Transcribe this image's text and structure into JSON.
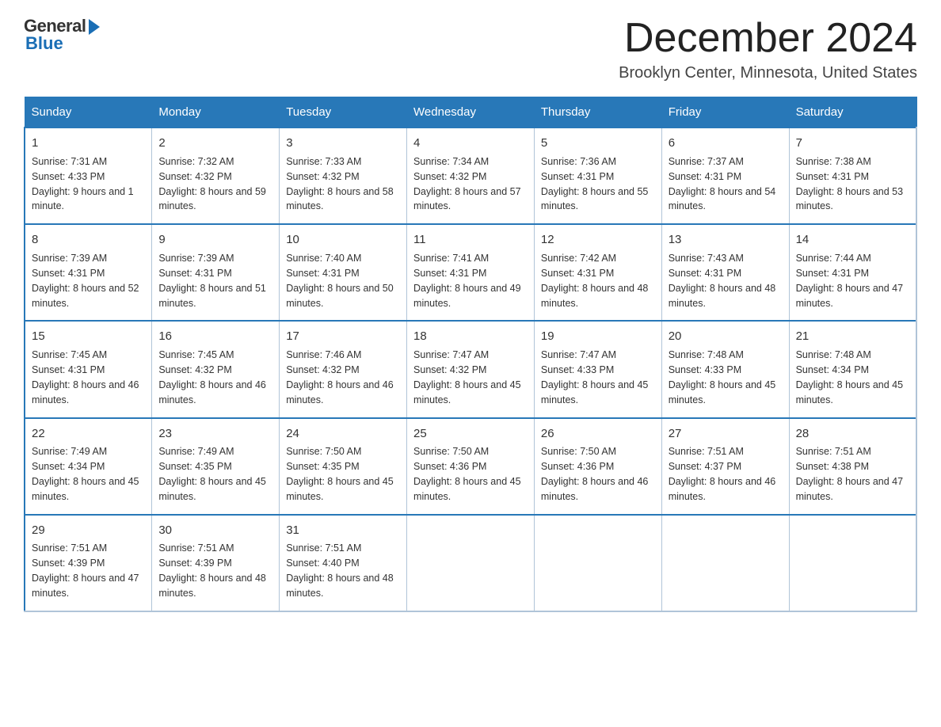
{
  "header": {
    "logo_general": "General",
    "logo_blue": "Blue",
    "month_title": "December 2024",
    "location": "Brooklyn Center, Minnesota, United States"
  },
  "days_of_week": [
    "Sunday",
    "Monday",
    "Tuesday",
    "Wednesday",
    "Thursday",
    "Friday",
    "Saturday"
  ],
  "weeks": [
    [
      {
        "day": "1",
        "sunrise": "7:31 AM",
        "sunset": "4:33 PM",
        "daylight": "9 hours and 1 minute."
      },
      {
        "day": "2",
        "sunrise": "7:32 AM",
        "sunset": "4:32 PM",
        "daylight": "8 hours and 59 minutes."
      },
      {
        "day": "3",
        "sunrise": "7:33 AM",
        "sunset": "4:32 PM",
        "daylight": "8 hours and 58 minutes."
      },
      {
        "day": "4",
        "sunrise": "7:34 AM",
        "sunset": "4:32 PM",
        "daylight": "8 hours and 57 minutes."
      },
      {
        "day": "5",
        "sunrise": "7:36 AM",
        "sunset": "4:31 PM",
        "daylight": "8 hours and 55 minutes."
      },
      {
        "day": "6",
        "sunrise": "7:37 AM",
        "sunset": "4:31 PM",
        "daylight": "8 hours and 54 minutes."
      },
      {
        "day": "7",
        "sunrise": "7:38 AM",
        "sunset": "4:31 PM",
        "daylight": "8 hours and 53 minutes."
      }
    ],
    [
      {
        "day": "8",
        "sunrise": "7:39 AM",
        "sunset": "4:31 PM",
        "daylight": "8 hours and 52 minutes."
      },
      {
        "day": "9",
        "sunrise": "7:39 AM",
        "sunset": "4:31 PM",
        "daylight": "8 hours and 51 minutes."
      },
      {
        "day": "10",
        "sunrise": "7:40 AM",
        "sunset": "4:31 PM",
        "daylight": "8 hours and 50 minutes."
      },
      {
        "day": "11",
        "sunrise": "7:41 AM",
        "sunset": "4:31 PM",
        "daylight": "8 hours and 49 minutes."
      },
      {
        "day": "12",
        "sunrise": "7:42 AM",
        "sunset": "4:31 PM",
        "daylight": "8 hours and 48 minutes."
      },
      {
        "day": "13",
        "sunrise": "7:43 AM",
        "sunset": "4:31 PM",
        "daylight": "8 hours and 48 minutes."
      },
      {
        "day": "14",
        "sunrise": "7:44 AM",
        "sunset": "4:31 PM",
        "daylight": "8 hours and 47 minutes."
      }
    ],
    [
      {
        "day": "15",
        "sunrise": "7:45 AM",
        "sunset": "4:31 PM",
        "daylight": "8 hours and 46 minutes."
      },
      {
        "day": "16",
        "sunrise": "7:45 AM",
        "sunset": "4:32 PM",
        "daylight": "8 hours and 46 minutes."
      },
      {
        "day": "17",
        "sunrise": "7:46 AM",
        "sunset": "4:32 PM",
        "daylight": "8 hours and 46 minutes."
      },
      {
        "day": "18",
        "sunrise": "7:47 AM",
        "sunset": "4:32 PM",
        "daylight": "8 hours and 45 minutes."
      },
      {
        "day": "19",
        "sunrise": "7:47 AM",
        "sunset": "4:33 PM",
        "daylight": "8 hours and 45 minutes."
      },
      {
        "day": "20",
        "sunrise": "7:48 AM",
        "sunset": "4:33 PM",
        "daylight": "8 hours and 45 minutes."
      },
      {
        "day": "21",
        "sunrise": "7:48 AM",
        "sunset": "4:34 PM",
        "daylight": "8 hours and 45 minutes."
      }
    ],
    [
      {
        "day": "22",
        "sunrise": "7:49 AM",
        "sunset": "4:34 PM",
        "daylight": "8 hours and 45 minutes."
      },
      {
        "day": "23",
        "sunrise": "7:49 AM",
        "sunset": "4:35 PM",
        "daylight": "8 hours and 45 minutes."
      },
      {
        "day": "24",
        "sunrise": "7:50 AM",
        "sunset": "4:35 PM",
        "daylight": "8 hours and 45 minutes."
      },
      {
        "day": "25",
        "sunrise": "7:50 AM",
        "sunset": "4:36 PM",
        "daylight": "8 hours and 45 minutes."
      },
      {
        "day": "26",
        "sunrise": "7:50 AM",
        "sunset": "4:36 PM",
        "daylight": "8 hours and 46 minutes."
      },
      {
        "day": "27",
        "sunrise": "7:51 AM",
        "sunset": "4:37 PM",
        "daylight": "8 hours and 46 minutes."
      },
      {
        "day": "28",
        "sunrise": "7:51 AM",
        "sunset": "4:38 PM",
        "daylight": "8 hours and 47 minutes."
      }
    ],
    [
      {
        "day": "29",
        "sunrise": "7:51 AM",
        "sunset": "4:39 PM",
        "daylight": "8 hours and 47 minutes."
      },
      {
        "day": "30",
        "sunrise": "7:51 AM",
        "sunset": "4:39 PM",
        "daylight": "8 hours and 48 minutes."
      },
      {
        "day": "31",
        "sunrise": "7:51 AM",
        "sunset": "4:40 PM",
        "daylight": "8 hours and 48 minutes."
      },
      null,
      null,
      null,
      null
    ]
  ]
}
